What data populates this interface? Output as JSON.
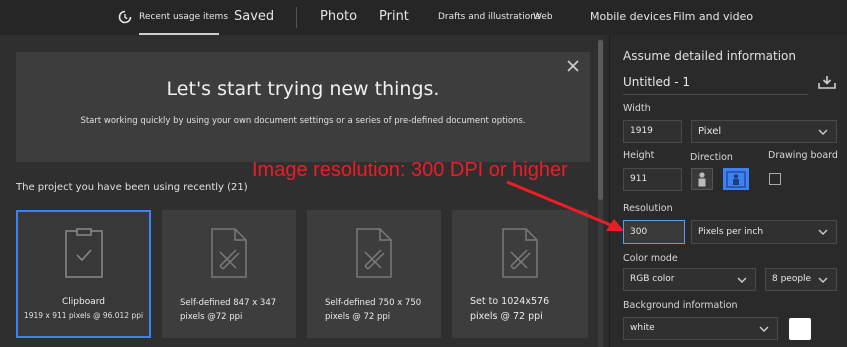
{
  "tabs": [
    {
      "label": "Recent usage items",
      "active": true
    },
    {
      "label": "Saved"
    },
    {
      "label": "Photo"
    },
    {
      "label": "Print"
    },
    {
      "label": "Drafts and illustrations"
    },
    {
      "label": "Web"
    },
    {
      "label": "Mobile devices"
    },
    {
      "label": "Film and video"
    }
  ],
  "banner": {
    "title": "Let's start trying new things.",
    "subtitle": "Start working quickly by using your own document settings or a series of pre-defined document options."
  },
  "recent": {
    "title": "The project you have been using recently (21)",
    "items": [
      {
        "name": "Clipboard",
        "detail": "1919 x 911 pixels @ 96.012 ppi",
        "selected": true
      },
      {
        "name": "Self-defined 847 x 347",
        "detail": "pixels @72 ppi"
      },
      {
        "name": "Self-defined 750 x 750",
        "detail": "pixels @ 72 ppi"
      },
      {
        "name": "Set to 1024x576",
        "detail": "pixels @ 72 ppi"
      }
    ]
  },
  "annotation": "Image resolution: 300 DPI or higher",
  "details": {
    "title": "Assume detailed information",
    "doc_name": "Untitled - 1",
    "width_label": "Width",
    "width_value": "1919",
    "unit": "Pixel",
    "height_label": "Height",
    "height_value": "911",
    "direction_label": "Direction",
    "drawing_board_label": "Drawing board",
    "resolution_label": "Resolution",
    "resolution_value": "300",
    "resolution_unit": "Pixels per inch",
    "color_mode_label": "Color mode",
    "color_mode": "RGB color",
    "bit_depth": "8 people",
    "background_label": "Background information",
    "background": "white",
    "background_swatch": "#ffffff"
  },
  "colors": {
    "accent": "#3b82f6",
    "annotation": "#ee1c24"
  }
}
